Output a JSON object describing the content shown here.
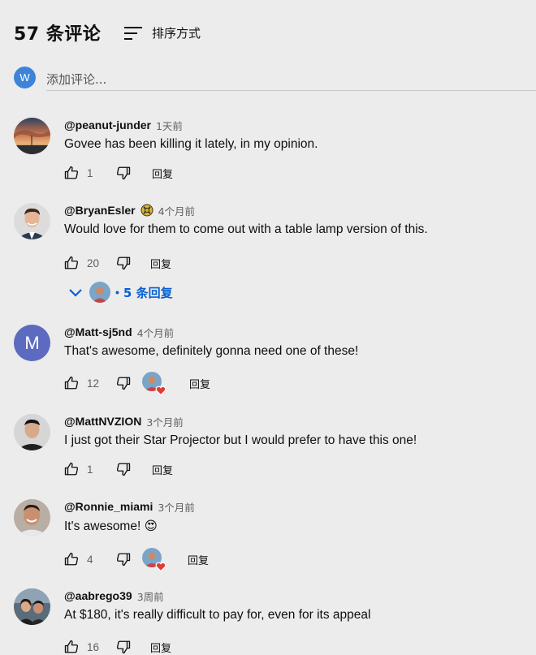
{
  "header": {
    "count_label": "57 条评论",
    "sort_label": "排序方式"
  },
  "add_comment": {
    "user_initial": "W",
    "placeholder": "添加评论..."
  },
  "colors": {
    "accent": "#065fd4",
    "user_badge": "#3d84d8",
    "letter_avatar": "#5c6bc0",
    "heart": "#e53935"
  },
  "comments": [
    {
      "author": "@peanut-junder",
      "time": "1天前",
      "text": "Govee has been killing it lately, in my opinion.",
      "likes": "1",
      "reply_label": "回复",
      "avatar_icon": "sunset-photo-avatar"
    },
    {
      "author": "@BryanEsler",
      "time": "4个月前",
      "text": "Would love for them to come out with a table lamp version of this.",
      "likes": "20",
      "reply_label": "回复",
      "avatar_icon": "man-portrait-avatar",
      "badge_icon": "member-badge-icon"
    },
    {
      "author": "@Matt-sj5nd",
      "time": "4个月前",
      "text": "That's awesome, definitely gonna need one of these!",
      "likes": "12",
      "reply_label": "回复",
      "avatar_letter": "M",
      "hearted": true
    },
    {
      "author": "@MattNVZION",
      "time": "3个月前",
      "text": "I just got their Star Projector but I would prefer to have this one!",
      "likes": "1",
      "reply_label": "回复",
      "avatar_icon": "man-portrait-avatar"
    },
    {
      "author": "@Ronnie_miami",
      "time": "3个月前",
      "text": "It's awesome!",
      "emoji": "😍",
      "likes": "4",
      "reply_label": "回复",
      "avatar_icon": "man-smiling-avatar",
      "hearted": true
    },
    {
      "author": "@aabrego39",
      "time": "3周前",
      "text": "At $180, it's really difficult to pay for, even for its appeal",
      "likes": "16",
      "reply_label": "回复",
      "avatar_icon": "couple-photo-avatar"
    }
  ],
  "replies_toggle": {
    "label": "5 条回复"
  }
}
